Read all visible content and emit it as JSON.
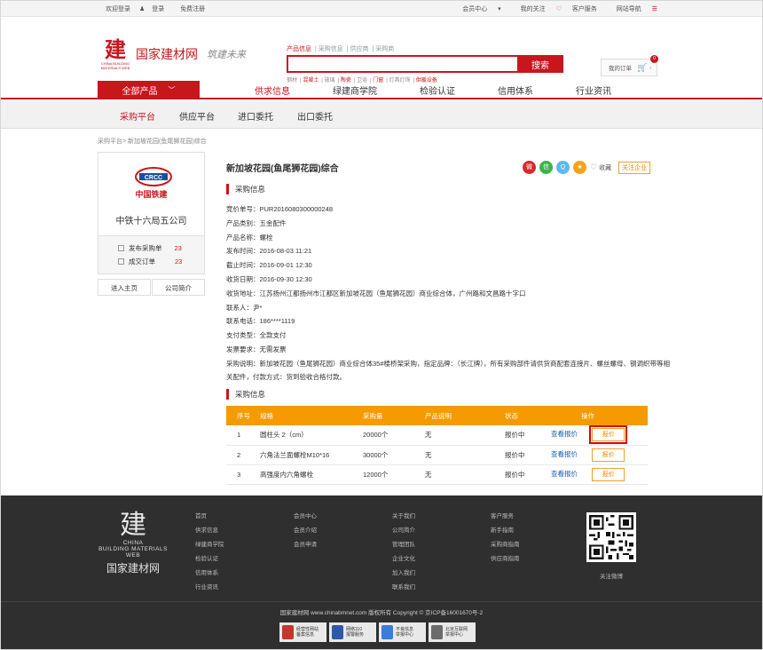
{
  "topbar": {
    "welcome": "欢迎登录",
    "login": "登录",
    "register": "免费注册",
    "member_center": "会员中心",
    "my_follow": "我的关注",
    "customer_service": "客户服务",
    "site_nav": "网站导航"
  },
  "logo": {
    "mark": "建",
    "en": "CHINA BUILDING MATERIALS WEB",
    "name": "国家建材网",
    "slogan": "筑建未来"
  },
  "search": {
    "tabs": [
      "产品信息",
      "采购信息",
      "供应商",
      "采购商"
    ],
    "button": "搜索",
    "hotwords": [
      "钢材",
      "混凝土",
      "玻璃",
      "陶瓷",
      "卫浴",
      "门窗",
      "灯具灯饰",
      "供暖设备"
    ]
  },
  "header": {
    "my_orders": "我的订单",
    "cart_count": "0"
  },
  "mainnav": {
    "all": "全部产品",
    "items": [
      "供求信息",
      "绿建商学院",
      "检验认证",
      "信用体系",
      "行业资讯"
    ]
  },
  "subnav": {
    "items": [
      "采购平台",
      "供应平台",
      "进口委托",
      "出口委托"
    ]
  },
  "breadcrumb": "采购平台> 新加坡花园(鱼尾狮花园)综合",
  "company": {
    "logo_text": "中国铁建",
    "name": "中铁十六局五公司",
    "purchases_label": "发布采购单",
    "purchases_count": "23",
    "deals_label": "成交订单",
    "deals_count": "23",
    "home_btn": "进入主页",
    "intro_btn": "公司简介"
  },
  "purchase": {
    "title": "新加坡花园(鱼尾狮花园)综合",
    "fav": "收藏",
    "follow": "关注企业",
    "section1": "采购信息",
    "section2": "采购信息",
    "fields": [
      "竞价单号：PUR2016080300000248",
      "产品类别：五金配件",
      "产品名称：螺栓",
      "发布时间：2016-08-03 11:21",
      "截止时间：2016-09-01 12:30",
      "收货日期：2016-09-30 12:30",
      "收货地址：江苏扬州江都扬州市江都区新加坡花园（鱼尾狮花园）商业综合体，广州路和文昌路十字口",
      "联系人：尹*",
      "联系电话：186****1119",
      "支付类型：全款支付",
      "发票要求：无需发票"
    ],
    "description": "采购说明：新加坡花园（鱼尾狮花园）商业综合体35#楼桥架采购，指定品牌：（长江牌），所有采购部件请供货商配套连接片、螺丝螺母、钢调织带等相关配件，付款方式：货到验收合格付款。"
  },
  "table": {
    "headers": [
      "序号",
      "规格",
      "采购量",
      "产品说明",
      "状态",
      "操作"
    ],
    "rows": [
      {
        "no": "1",
        "spec": "圆柱头 2（cm）",
        "qty": "20000个",
        "desc": "无",
        "status": "报价中",
        "view": "查看报价",
        "quote": "报价"
      },
      {
        "no": "2",
        "spec": "六角法兰面螺栓M10*16",
        "qty": "30000个",
        "desc": "无",
        "status": "报价中",
        "view": "查看报价",
        "quote": "报价"
      },
      {
        "no": "3",
        "spec": "高强度内六角螺栓",
        "qty": "12000个",
        "desc": "无",
        "status": "报价中",
        "view": "查看报价",
        "quote": "报价"
      }
    ]
  },
  "footer": {
    "logo_en1": "CHINA",
    "logo_en2": "BUILDING MATERIALS WEB",
    "logo_cn": "国家建材网",
    "col1": [
      "首页",
      "供求信息",
      "绿建商学院",
      "检验认证",
      "信用体系",
      "行业资讯"
    ],
    "col2": [
      "会员中心",
      "会员介绍",
      "会员申请"
    ],
    "col3": [
      "关于我们",
      "公司简介",
      "管理团队",
      "企业文化",
      "加入我们",
      "联系我们"
    ],
    "col4": [
      "客户服务",
      "新手指南",
      "采购商指南",
      "供应商指南"
    ],
    "qr_label": "关注微博",
    "copyright": "国家建材网 www.chinabmnet.com 版权所有 Copyright © 京ICP备16001670号-2",
    "certs": [
      {
        "l1": "经营性网站",
        "l2": "备案信息"
      },
      {
        "l1": "网络110",
        "l2": "报警服务"
      },
      {
        "l1": "不良信息",
        "l2": "举报中心"
      },
      {
        "l1": "北京互联网",
        "l2": "举报中心"
      }
    ]
  }
}
